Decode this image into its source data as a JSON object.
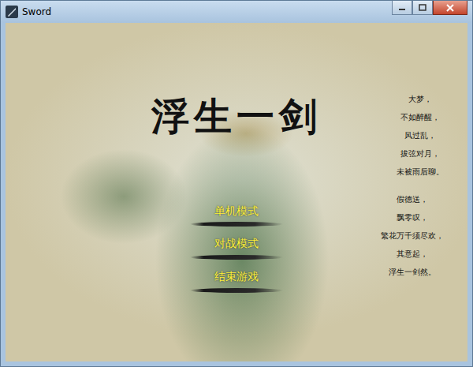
{
  "window": {
    "title": "Sword"
  },
  "game_title": "浮生一剑",
  "poem": [
    [
      "大梦，",
      "不如醉醒，",
      "风过乱，",
      "拔弦对月，",
      "未被雨后聊。"
    ],
    [
      "假德送，",
      "飘零叹，",
      "繁花万千须尽欢，",
      "其意起，",
      "浮生一剑然。"
    ]
  ],
  "menu": [
    {
      "label": "单机模式"
    },
    {
      "label": "对战模式"
    },
    {
      "label": "结束游戏"
    }
  ]
}
